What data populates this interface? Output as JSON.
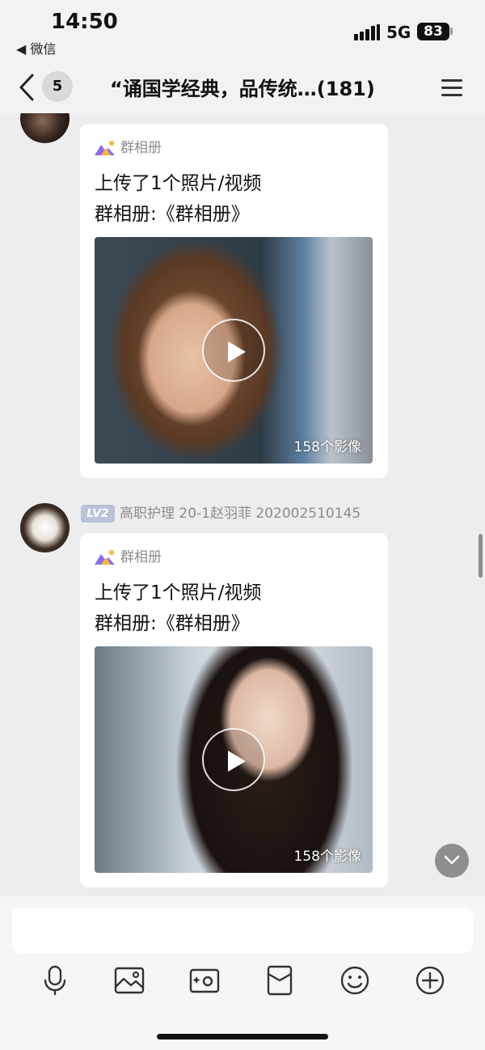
{
  "status_bar": {
    "time": "14:50",
    "back_app": "◀ 微信",
    "network": "5G",
    "battery": "83"
  },
  "nav": {
    "unread_count": "5",
    "title": "“诵国学经典，品传统…(181)"
  },
  "messages": [
    {
      "source_label": "群相册",
      "line1": "上传了1个照片/视频",
      "line2": "群相册:《群相册》",
      "media_count": "158个影像"
    },
    {
      "level": "LV2",
      "sender_name": "高职护理 20-1赵羽菲 202002510145",
      "source_label": "群相册",
      "line1": "上传了1个照片/视频",
      "line2": "群相册:《群相册》",
      "media_count": "158个影像"
    }
  ],
  "toolbar": {
    "icons": [
      "microphone-icon",
      "image-icon",
      "camera-icon",
      "red-packet-icon",
      "emoji-icon",
      "plus-icon"
    ]
  },
  "colors": {
    "background": "#ededed",
    "card": "#ffffff",
    "secondary_text": "#8c8c8c",
    "level_badge": "#b8c2d8",
    "album_icon_gold": "#f7b733",
    "album_icon_purple": "#8b6cf6"
  }
}
